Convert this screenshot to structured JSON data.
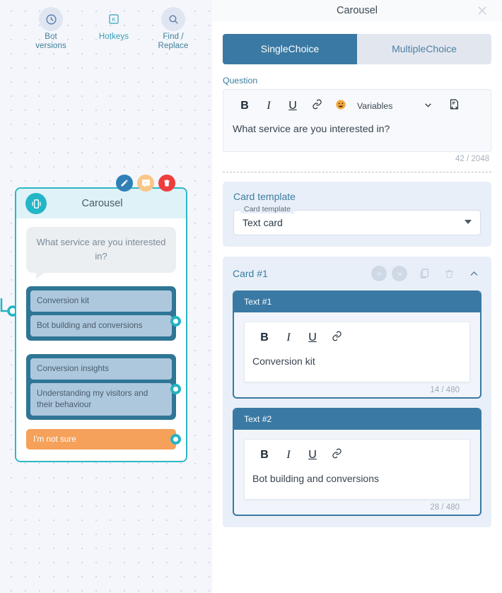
{
  "canvas": {
    "toolbar": [
      {
        "id": "bot-versions",
        "label_line1": "Bot",
        "label_line2": "versions",
        "icon": "history-icon"
      },
      {
        "id": "hotkeys",
        "label_line1": "Hotkeys",
        "label_line2": "",
        "icon": "keyboard-key-icon"
      },
      {
        "id": "find-replace",
        "label_line1": "Find /",
        "label_line2": "Replace",
        "icon": "search-icon"
      }
    ],
    "node": {
      "title": "Carousel",
      "icon": "carousel-icon",
      "bubble_text": "What service are you interested in?",
      "actions": [
        {
          "id": "edit",
          "icon": "pencil-icon",
          "color": "#2f80b7"
        },
        {
          "id": "comment",
          "icon": "comment-icon",
          "color": "#fac687"
        },
        {
          "id": "delete",
          "icon": "trash-icon",
          "color": "#ef3d3d"
        }
      ],
      "groups": [
        {
          "options": [
            "Conversion kit",
            "Bot building and conversions"
          ]
        },
        {
          "options": [
            "Conversion insights",
            "Understanding my visitors and their behaviour"
          ]
        }
      ],
      "fallback_option": "I'm not sure"
    }
  },
  "panel": {
    "title": "Carousel",
    "close_icon": "close-icon",
    "tabs": [
      {
        "label": "SingleChoice",
        "active": true
      },
      {
        "label": "MultipleChoice",
        "active": false
      }
    ],
    "question": {
      "label": "Question",
      "toolbar": {
        "bold": "B",
        "italic": "I",
        "underline": "U",
        "link_icon": "link-icon",
        "emoji_icon": "emoji-icon",
        "variables_label": "Variables",
        "caret_icon": "chevron-down-icon",
        "code_icon": "code-snippet-icon"
      },
      "value": "What service are you interested in?",
      "counter": "42 / 2048"
    },
    "card_template": {
      "section_title": "Card template",
      "field_legend": "Card template",
      "value": "Text card",
      "caret_icon": "chevron-down-icon"
    },
    "card": {
      "title": "Card #1",
      "controls": [
        {
          "id": "move-up",
          "icon": "chevron-up-icon"
        },
        {
          "id": "move-down",
          "icon": "chevron-down-icon"
        },
        {
          "id": "duplicate",
          "icon": "copy-icon"
        },
        {
          "id": "delete",
          "icon": "trash-icon"
        },
        {
          "id": "collapse",
          "icon": "chevron-up-icon"
        }
      ],
      "text_blocks": [
        {
          "header": "Text #1",
          "toolbar": {
            "bold": "B",
            "italic": "I",
            "underline": "U",
            "link_icon": "link-icon"
          },
          "value": "Conversion kit",
          "counter": "14 / 480"
        },
        {
          "header": "Text #2",
          "toolbar": {
            "bold": "B",
            "italic": "I",
            "underline": "U",
            "link_icon": "link-icon"
          },
          "value": "Bot building and conversions",
          "counter": "28 / 480"
        }
      ]
    }
  },
  "colors": {
    "accent_blue": "#3a79a3",
    "teal": "#23b6c7",
    "orange": "#f5a15a",
    "red": "#ef3d3d",
    "panel_section_bg": "#e9eff8"
  }
}
